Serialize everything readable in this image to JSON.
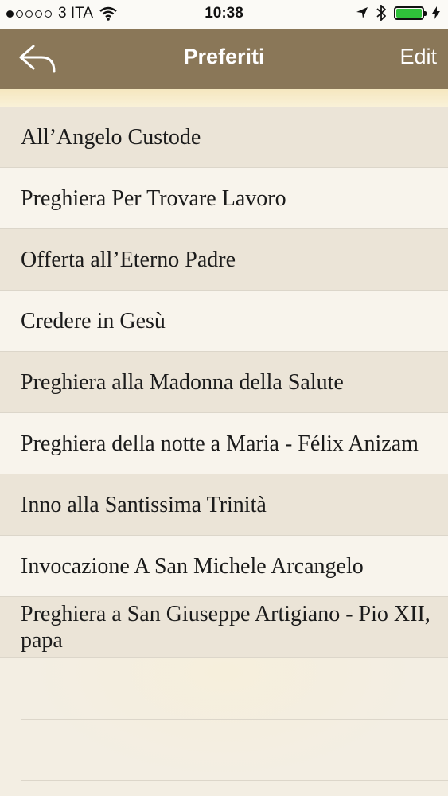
{
  "status_bar": {
    "carrier": "3 ITA",
    "time": "10:38",
    "signal_filled": 1,
    "signal_total": 5,
    "battery_level": 1.0,
    "battery_color": "#2fc13a"
  },
  "nav": {
    "title": "Preferiti",
    "edit_label": "Edit",
    "back_icon": "back-arrow-icon",
    "color": "#8a7758"
  },
  "favorites": [
    "All’Angelo Custode",
    "Preghiera Per Trovare Lavoro",
    "Offerta all’Eterno Padre",
    "Credere in Gesù",
    "Preghiera alla Madonna della Salute",
    "Preghiera della notte a Maria - Félix Anizam",
    "Inno alla Santissima Trinità",
    "Invocazione A San Michele Arcangelo",
    "Preghiera a San Giuseppe Artigiano - Pio XII, papa"
  ]
}
